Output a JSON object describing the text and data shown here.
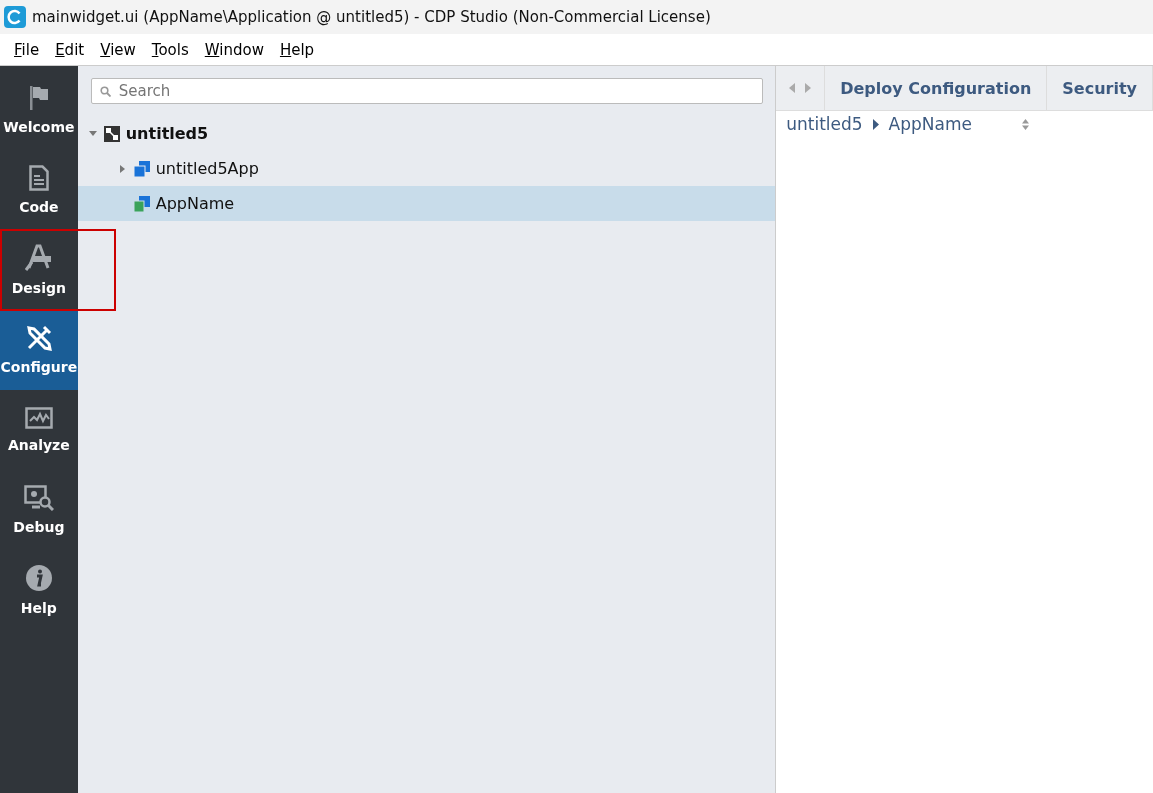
{
  "window": {
    "title": "mainwidget.ui (AppName\\Application @ untitled5) - CDP Studio (Non-Commercial License)"
  },
  "menu": [
    "File",
    "Edit",
    "View",
    "Tools",
    "Window",
    "Help"
  ],
  "modes": [
    {
      "label": "Welcome",
      "kind": "flag",
      "selected": false,
      "highlighted": false
    },
    {
      "label": "Code",
      "kind": "document",
      "selected": false,
      "highlighted": false
    },
    {
      "label": "Design",
      "kind": "design",
      "selected": false,
      "highlighted": true
    },
    {
      "label": "Configure",
      "kind": "tools",
      "selected": true,
      "highlighted": false
    },
    {
      "label": "Analyze",
      "kind": "monitor",
      "selected": false,
      "highlighted": false
    },
    {
      "label": "Debug",
      "kind": "debug",
      "selected": false,
      "highlighted": false
    },
    {
      "label": "Help",
      "kind": "info",
      "selected": false,
      "highlighted": false
    }
  ],
  "search": {
    "placeholder": "Search"
  },
  "tree": [
    {
      "label": "untitled5",
      "kind": "system",
      "expanded": true,
      "selected": false,
      "children": [
        {
          "label": "untitled5App",
          "kind": "app",
          "expanded": false,
          "selected": false
        },
        {
          "label": "AppName",
          "kind": "qtapp",
          "selected": true
        }
      ]
    }
  ],
  "right_tabs": [
    "Deploy Configuration",
    "Security"
  ],
  "breadcrumb": [
    "untitled5",
    "AppName"
  ]
}
